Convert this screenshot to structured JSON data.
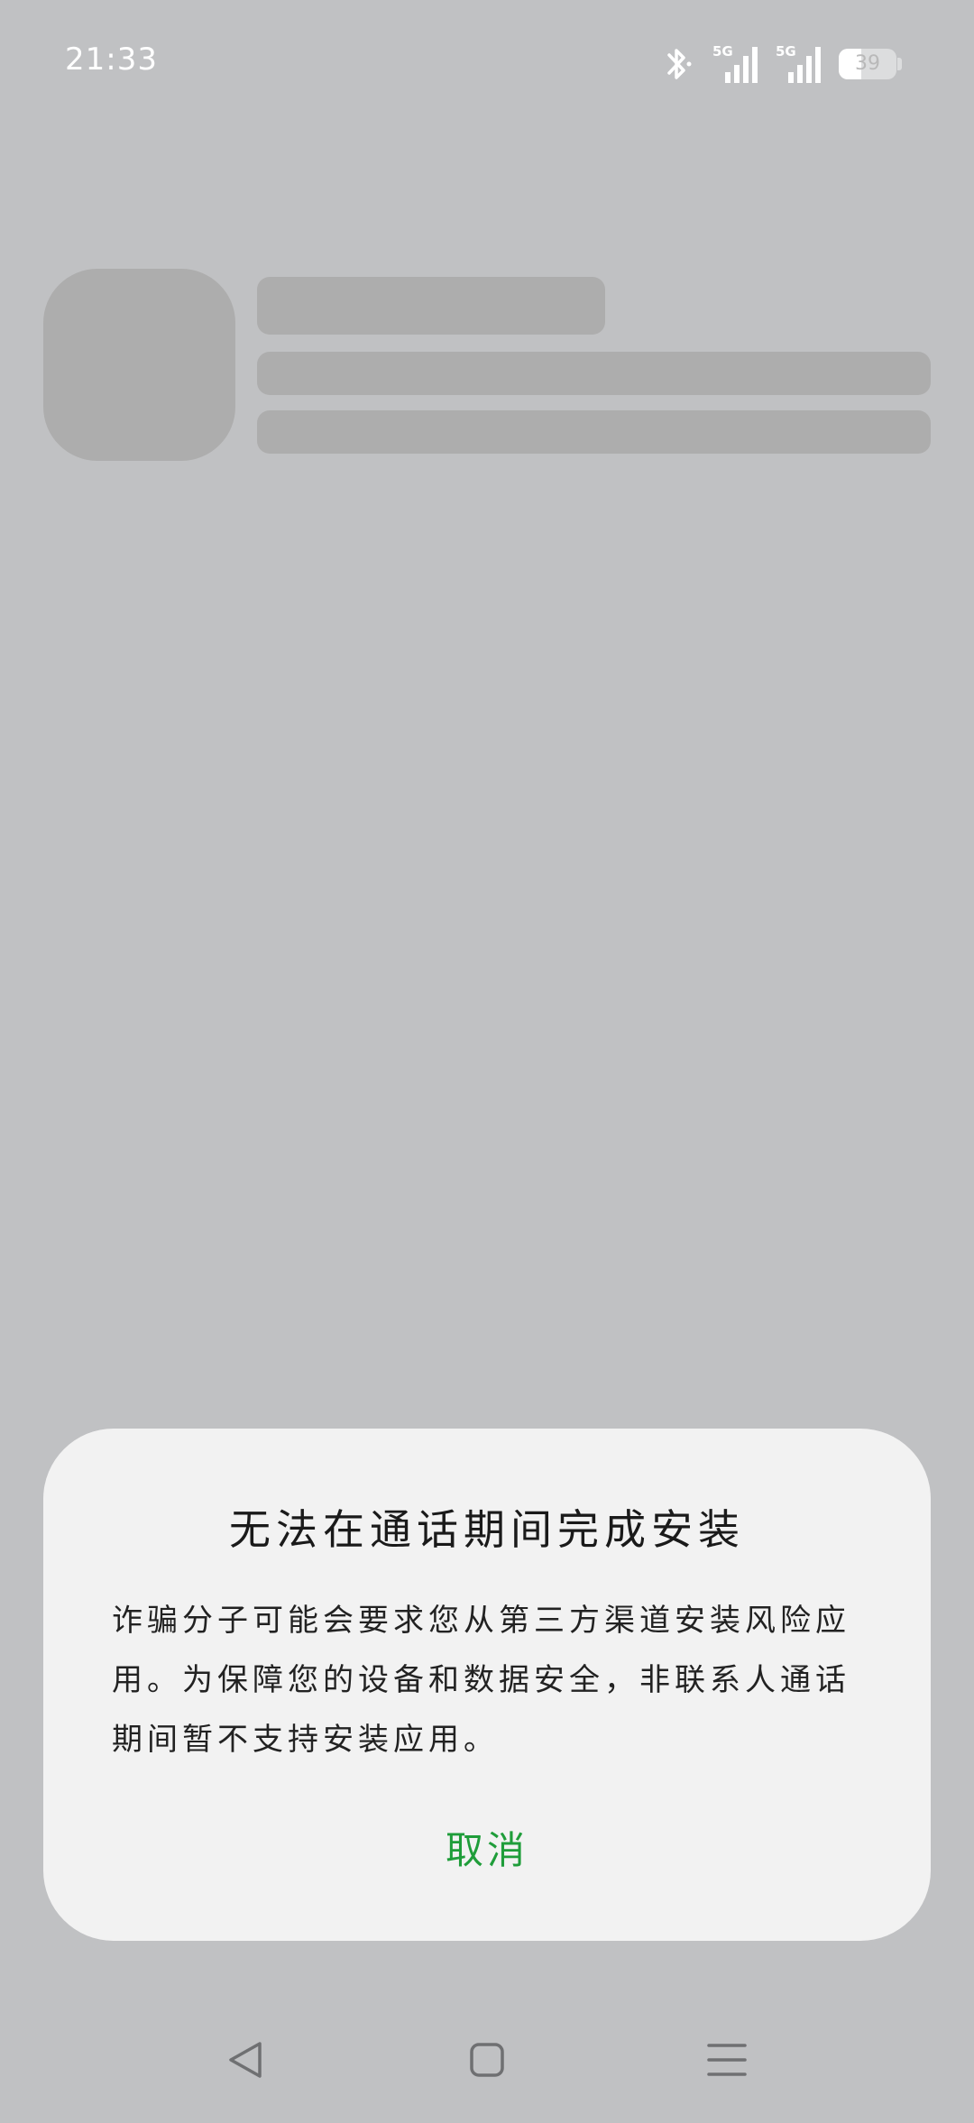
{
  "status_bar": {
    "time": "21:33",
    "signal_1_label": "5G",
    "signal_2_label": "5G",
    "battery_level": "39",
    "battery_fraction": 0.39,
    "icons": [
      "bluetooth-icon",
      "signal-5g-icon",
      "signal-5g-icon",
      "battery-icon"
    ]
  },
  "dialog": {
    "title": "无法在通话期间完成安装",
    "message": "诈骗分子可能会要求您从第三方渠道安装风险应用。为保障您的设备和数据安全，非联系人通话期间暂不支持安装应用。",
    "cancel_label": "取消",
    "accent_color": "#1f9d3a"
  },
  "nav_bar": {
    "icons": [
      "back-icon",
      "home-icon",
      "recents-icon"
    ]
  }
}
